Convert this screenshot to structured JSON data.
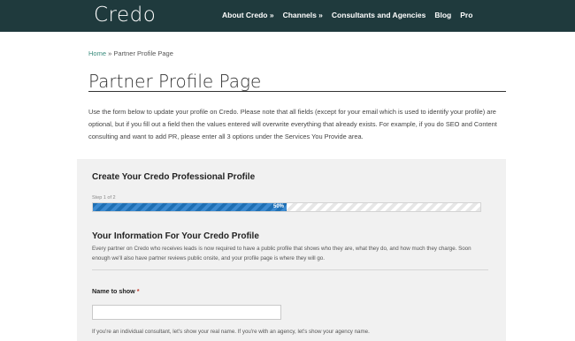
{
  "header": {
    "logo": "Credo",
    "nav": [
      {
        "label": "About Credo »"
      },
      {
        "label": "Channels »"
      },
      {
        "label": "Consultants and Agencies"
      },
      {
        "label": "Blog"
      },
      {
        "label": "Pro"
      }
    ]
  },
  "breadcrumb": {
    "home": "Home",
    "separator": " » ",
    "current": "Partner Profile Page"
  },
  "page": {
    "title": "Partner Profile Page",
    "intro": "Use the form below to update your profile on Credo. Please note that all fields (except for your email which is used to identify your profile) are optional, but if you fill out a field then the values entered will overwrite everything that already exists. For example, if you do SEO and Content consulting and want to add PR, please enter all 3 options under the Services You Provide area."
  },
  "form": {
    "title": "Create Your Credo Professional Profile",
    "step_text": "Step 1 of 2",
    "progress_percent": 50,
    "progress_label": "50%",
    "section": {
      "title": "Your Information For Your Credo Profile",
      "description": "Every partner on Credo who receives leads is now required to have a public profile that shows who they are, what they do, and how much they charge. Soon enough we'll also have partner reviews public onsite, and your profile page is where they will go."
    },
    "fields": {
      "name": {
        "label": "Name to show",
        "required_marker": "*",
        "value": "",
        "help": "If you're an individual consultant, let's show your real name. If you're with an agency, let's show your agency name."
      }
    }
  },
  "colors": {
    "topbar": "#1f3a3d",
    "link": "#3b8c7d",
    "progress": "#2a7dc2",
    "panel": "#f1f1f1"
  }
}
